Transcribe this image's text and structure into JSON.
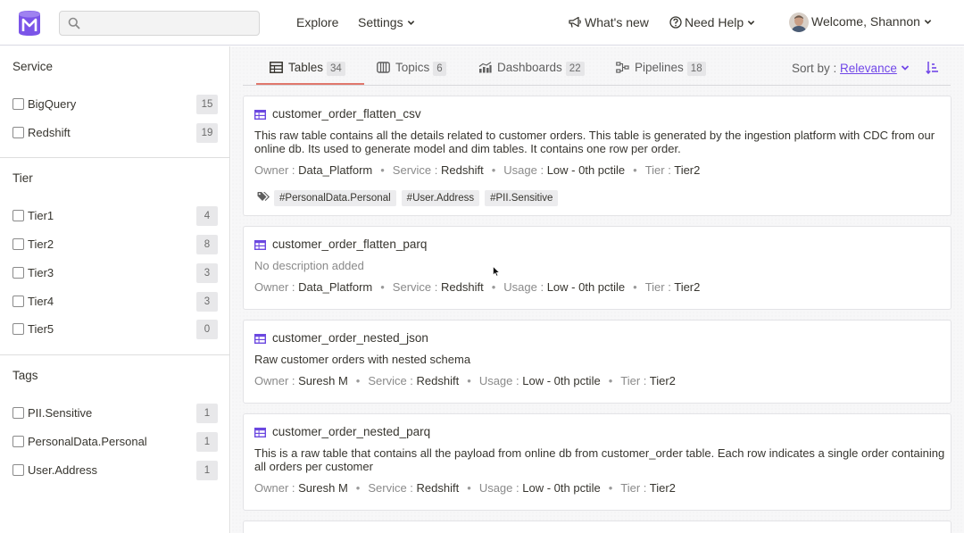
{
  "header": {
    "search": {
      "placeholder": "",
      "value": ""
    },
    "nav": {
      "explore": "Explore",
      "settings": "Settings",
      "whats_new": "What's new",
      "need_help": "Need Help",
      "welcome": "Welcome, Shannon"
    }
  },
  "sidebar": {
    "groups": [
      {
        "title": "Service",
        "items": [
          {
            "label": "BigQuery",
            "count": "15"
          },
          {
            "label": "Redshift",
            "count": "19"
          }
        ]
      },
      {
        "title": "Tier",
        "items": [
          {
            "label": "Tier1",
            "count": "4"
          },
          {
            "label": "Tier2",
            "count": "8"
          },
          {
            "label": "Tier3",
            "count": "3"
          },
          {
            "label": "Tier4",
            "count": "3"
          },
          {
            "label": "Tier5",
            "count": "0"
          }
        ]
      },
      {
        "title": "Tags",
        "items": [
          {
            "label": "PII.Sensitive",
            "count": "1"
          },
          {
            "label": "PersonalData.Personal",
            "count": "1"
          },
          {
            "label": "User.Address",
            "count": "1"
          }
        ]
      }
    ]
  },
  "tabs": [
    {
      "label": "Tables",
      "count": "34",
      "icon": "table-icon"
    },
    {
      "label": "Topics",
      "count": "6",
      "icon": "topic-icon"
    },
    {
      "label": "Dashboards",
      "count": "22",
      "icon": "dashboard-icon"
    },
    {
      "label": "Pipelines",
      "count": "18",
      "icon": "pipeline-icon"
    }
  ],
  "sort": {
    "label": "Sort by :",
    "value": "Relevance"
  },
  "meta_labels": {
    "owner": "Owner :",
    "service": "Service :",
    "usage": "Usage :",
    "tier": "Tier :"
  },
  "results": [
    {
      "name": "customer_order_flatten_csv",
      "description": "This raw table contains all the details related to customer orders. This table is generated by the ingestion platform with CDC from our online db. Its used to generate model and dim tables. It contains one row per order.",
      "owner": "Data_Platform",
      "service": "Redshift",
      "usage": "Low - 0th pctile",
      "tier": "Tier2",
      "tags": [
        "#PersonalData.Personal",
        "#User.Address",
        "#PII.Sensitive"
      ]
    },
    {
      "name": "customer_order_flatten_parq",
      "description": "No description added",
      "owner": "Data_Platform",
      "service": "Redshift",
      "usage": "Low - 0th pctile",
      "tier": "Tier2",
      "tags": []
    },
    {
      "name": "customer_order_nested_json",
      "description": "Raw customer orders with nested schema",
      "owner": "Suresh M",
      "service": "Redshift",
      "usage": "Low - 0th pctile",
      "tier": "Tier2",
      "tags": []
    },
    {
      "name": "customer_order_nested_parq",
      "description": "This is a raw table that contains all the payload from online db from customer_order table. Each row indicates a single order containing all orders per customer",
      "owner": "Suresh M",
      "service": "Redshift",
      "usage": "Low - 0th pctile",
      "tier": "Tier2",
      "tags": []
    }
  ],
  "colors": {
    "brand": "#7147e8",
    "accent_tab": "#e0776c",
    "logo_bg": "#7b54e8"
  }
}
